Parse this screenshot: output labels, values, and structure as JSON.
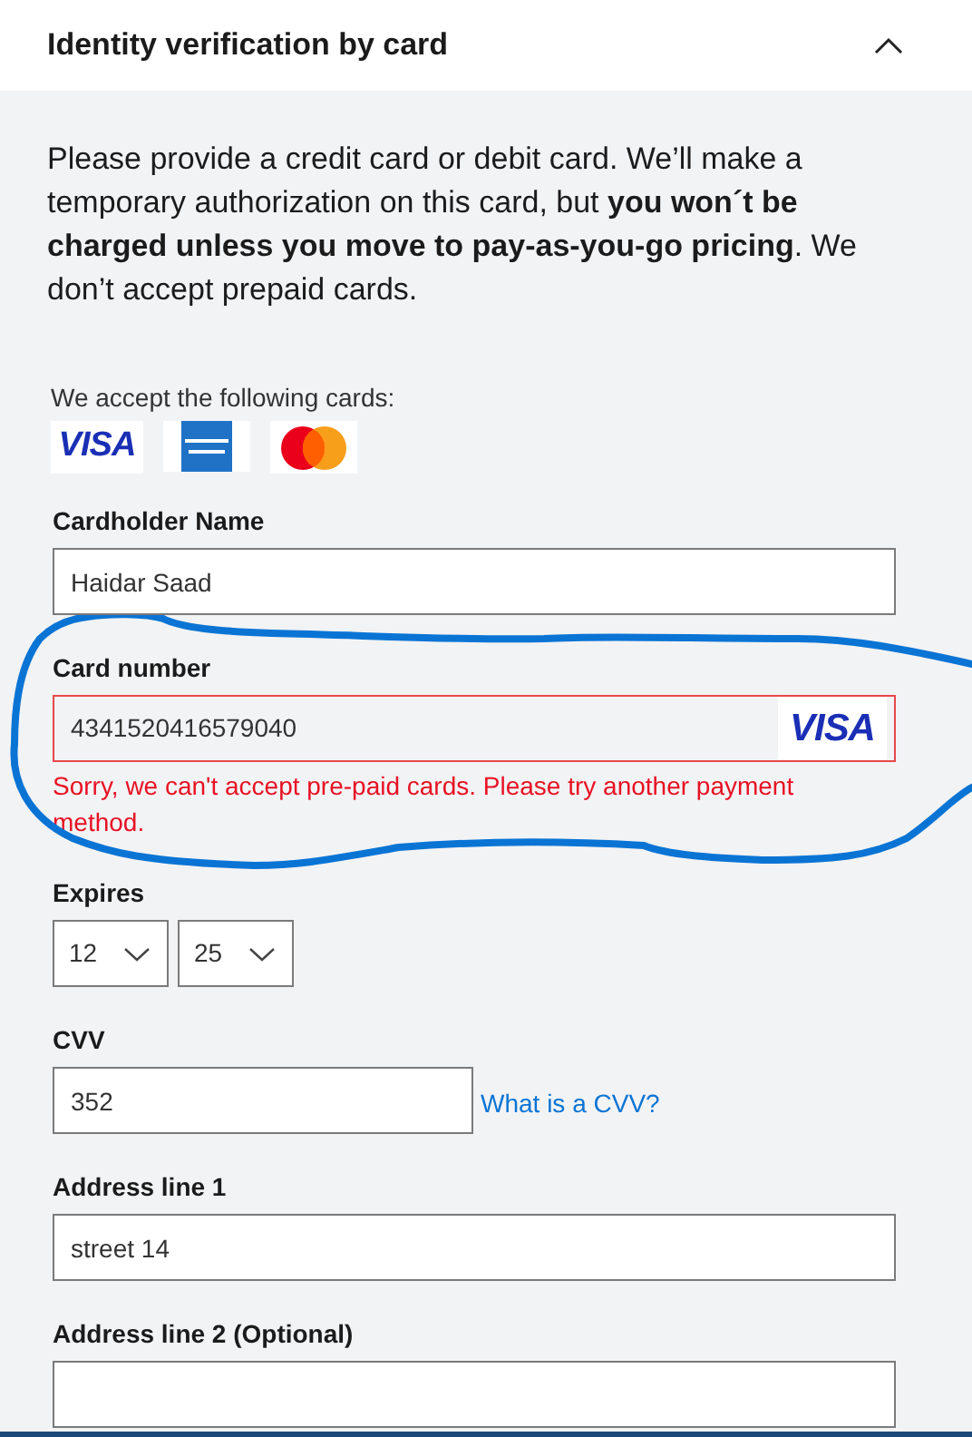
{
  "header": {
    "title": "Identity verification by card",
    "expanded": true
  },
  "intro": "Please provide a credit card or debit card. We’ll make a temporary authorization on this card, but **you won´t be charged unless you move to pay-as-you-go pricing**. We don’t accept prepaid cards.",
  "accepted": {
    "label": "We accept the following cards:",
    "cards": [
      {
        "kind": "visa",
        "text": "VISA"
      },
      {
        "kind": "amex"
      },
      {
        "kind": "mastercard"
      }
    ]
  },
  "fields": [
    {
      "kind": "text",
      "label": "Cardholder Name",
      "value": "Haidar Saad"
    },
    {
      "kind": "card",
      "label": "Card number",
      "value": "4341520416579040",
      "brand": "VISA",
      "invalid": true,
      "error": "Sorry, we can't accept pre-paid cards. Please try another payment method."
    },
    {
      "kind": "expiry",
      "label": "Expires",
      "month": "12",
      "year": "25"
    },
    {
      "kind": "cvv",
      "label": "CVV",
      "value": "352",
      "link": "What is a CVV?"
    },
    {
      "kind": "text",
      "label": "Address line 1",
      "value": "street 14"
    },
    {
      "kind": "text",
      "label": "Address line 2 (Optional)"
    }
  ]
}
